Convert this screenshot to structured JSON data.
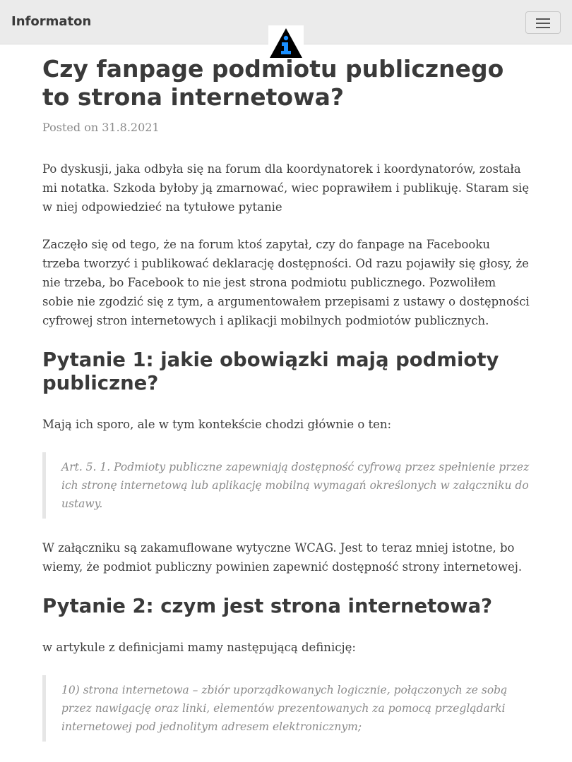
{
  "navbar": {
    "brand": "Informaton",
    "menu_icon": "hamburger-menu-icon"
  },
  "logo": {
    "icon": "info-triangle-logo-icon",
    "colors": {
      "triangle": "#000000",
      "letter": "#1a8fff"
    }
  },
  "article": {
    "title": "Czy fanpage podmiotu publicznego to strona internetowa?",
    "meta_prefix": "Posted on ",
    "date": "31.8.2021",
    "intro": "Po dyskusji, jaka odbyła się na forum dla koordynatorek i koordynatorów, została mi notatka. Szkoda byłoby ją zmarnować, wiec poprawiłem i publikuję. Staram się w niej odpowiedzieć na tytułowe pytanie",
    "para2": "Zaczęło się od tego, że na forum ktoś zapytał, czy do fanpage na Facebooku trzeba tworzyć i publikować deklarację dostępności. Od razu pojawiły się głosy, że nie trzeba, bo Facebook to nie jest strona podmiotu publicznego. Pozwoliłem sobie nie zgodzić się z tym, a argumentowałem przepisami z ustawy o dostępności cyfrowej stron internetowych i aplikacji mobilnych podmiotów publicznych.",
    "h2_1": "Pytanie 1: jakie obowiązki mają podmioty publiczne?",
    "para3": "Mają ich sporo, ale w tym kontekście chodzi głównie o ten:",
    "quote1": "Art. 5. 1. Podmioty publiczne zapewniają dostępność cyfrową przez spełnienie przez ich stronę internetową lub aplikację mobilną wymagań określonych w załączniku do ustawy.",
    "para4": "W załączniku są zakamuflowane wytyczne WCAG. Jest to teraz mniej istotne, bo wiemy, że podmiot publiczny powinien zapewnić dostępność strony internetowej.",
    "h2_2": "Pytanie 2: czym jest strona internetowa?",
    "para5": "w artykule z definicjami mamy następującą definicję:",
    "quote2": "10) strona internetowa – zbiór uporządkowanych logicznie, połączonych ze sobą przez nawigację oraz linki, elementów prezentowanych za pomocą przeglądarki internetowej pod jednolitym adresem elektronicznym;"
  }
}
